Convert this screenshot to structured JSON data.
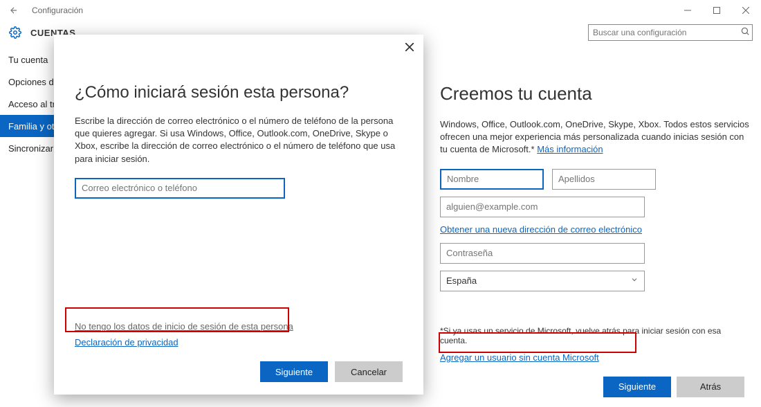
{
  "app": {
    "title": "Configuración",
    "section": "CUENTAS"
  },
  "search": {
    "placeholder": "Buscar una configuración"
  },
  "sidebar": {
    "items": [
      {
        "label": "Tu cuenta"
      },
      {
        "label": "Opciones de inicio de sesión"
      },
      {
        "label": "Acceso al trabajo"
      },
      {
        "label": "Familia y otros usuarios"
      },
      {
        "label": "Sincronizar la configuración"
      }
    ],
    "active_index": 3
  },
  "modal": {
    "title": "¿Cómo iniciará sesión esta persona?",
    "description": "Escribe la dirección de correo electrónico o el número de teléfono de la persona que quieres agregar. Si usa Windows, Office, Outlook.com, OneDrive, Skype o Xbox, escribe la dirección de correo electrónico o el número de teléfono que usa para iniciar sesión.",
    "input_placeholder": "Correo electrónico o teléfono",
    "no_info_link": "No tengo los datos de inicio de sesión de esta persona",
    "privacy_link": "Declaración de privacidad",
    "btn_next": "Siguiente",
    "btn_cancel": "Cancelar"
  },
  "create": {
    "title": "Creemos tu cuenta",
    "description": "Windows, Office, Outlook.com, OneDrive, Skype, Xbox. Todos estos servicios ofrecen una mejor experiencia más personalizada cuando inicias sesión con tu cuenta de Microsoft.* ",
    "more_info": "Más información",
    "first_placeholder": "Nombre",
    "last_placeholder": "Apellidos",
    "email_placeholder": "alguien@example.com",
    "get_email_link": "Obtener una nueva dirección de correo electrónico",
    "password_placeholder": "Contraseña",
    "country": "España",
    "note": "*Si ya usas un servicio de Microsoft, vuelve atrás para iniciar sesión con esa cuenta.",
    "add_without_link": "Agregar un usuario sin cuenta Microsoft",
    "btn_next": "Siguiente",
    "btn_back": "Atrás"
  },
  "ghost": {
    "o1": "o",
    "o2": "o",
    "n": "n",
    "il": "il"
  }
}
